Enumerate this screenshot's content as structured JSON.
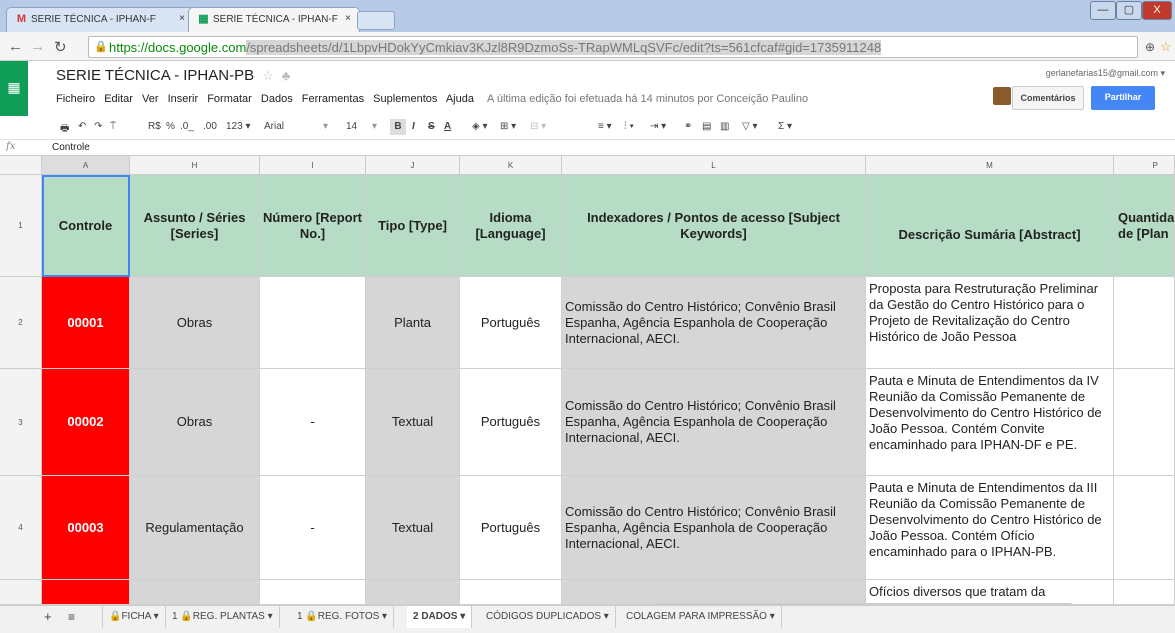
{
  "browser": {
    "tabs": [
      {
        "icon": "M",
        "label": "SERIE TÉCNICA - IPHAN-F",
        "close": "×"
      },
      {
        "icon": "▦",
        "label": "SERIE TÉCNICA - IPHAN-F",
        "close": "×"
      }
    ],
    "url_host": "https://docs.google.com",
    "url_path": "/spreadsheets/d/1LbpvHDokYyCmkiav3KJzl8R9DzmoSs-TRapWMLqSVFc/edit?ts=561cfcaf#gid=1735911248",
    "window_controls": [
      "—",
      "▢",
      "X"
    ]
  },
  "app": {
    "title": "SERIE TÉCNICA - IPHAN-PB",
    "menus": [
      "Ficheiro",
      "Editar",
      "Ver",
      "Inserir",
      "Formatar",
      "Dados",
      "Ferramentas",
      "Suplementos",
      "Ajuda"
    ],
    "last_edit": "A última edição foi efetuada há 14 minutos por Conceição Paulino",
    "email": "gerlanefarias15@gmail.com ▾",
    "comments_label": "Comentários",
    "share_label": "Partilhar"
  },
  "toolbar": {
    "currency": "R$",
    "percent": "%",
    "dec_less": ".0_",
    "dec_more": ".00",
    "format": "123 ▾",
    "font": "Arial",
    "font_size": "14",
    "bold": "B",
    "italic": "I",
    "strike": "S",
    "color": "A"
  },
  "formula_bar": {
    "fx": "fx",
    "value": "Controle"
  },
  "columns": [
    "A",
    "H",
    "I",
    "J",
    "K",
    "L",
    "M",
    "P"
  ],
  "headers": [
    "Controle",
    "Assunto / Séries [Series]",
    "Número [Report No.]",
    "Tipo [Type]",
    "Idioma [Language]",
    "Indexadores / Pontos de acesso [Subject Keywords]",
    "Descrição Sumária [Abstract]",
    "Quantida de [Plan"
  ],
  "row_numbers": [
    "1",
    "2",
    "3",
    "4"
  ],
  "rows": [
    {
      "controle": "00001",
      "assunto": "Obras",
      "numero": "",
      "tipo": "Planta",
      "idioma": "Português",
      "indexadores": "Comissão do Centro Histórico; Convênio Brasil Espanha, Agência Espanhola de Cooperação Internacional, AECI.",
      "descricao": "Proposta para Restruturação Preliminar da Gestão do Centro Histórico para o Projeto de Revitalização do Centro Histórico de João Pessoa"
    },
    {
      "controle": "00002",
      "assunto": "Obras",
      "numero": "-",
      "tipo": "Textual",
      "idioma": "Português",
      "indexadores": "Comissão do Centro Histórico; Convênio Brasil Espanha, Agência Espanhola de Cooperação Internacional, AECI.",
      "descricao": "Pauta e Minuta de Entendimentos da IV Reunião da Comissão Pemanente de Desenvolvimento do Centro Histórico de João Pessoa. Contém Convite encaminhado para IPHAN-DF e PE."
    },
    {
      "controle": "00003",
      "assunto": "Regulamentação",
      "numero": "-",
      "tipo": "Textual",
      "idioma": "Português",
      "indexadores": "Comissão do Centro Histórico; Convênio Brasil Espanha, Agência Espanhola de Cooperação Internacional, AECI.",
      "descricao": "Pauta e Minuta de Entendimentos da III Reunião da Comissão Pemanente de Desenvolvimento do Centro Histórico de João Pessoa. Contém Ofício encaminhado para o IPHAN-PB."
    }
  ],
  "partial_row_text": "Ofícios diversos que tratam da",
  "sheets": [
    {
      "label": "🔒FICHA ▾"
    },
    {
      "label": "1 🔒REG. PLANTAS ▾"
    },
    {
      "label": "1 🔒REG. FOTOS ▾"
    },
    {
      "label": "2 DADOS ▾"
    },
    {
      "label": "CÓDIGOS DUPLICADOS ▾"
    },
    {
      "label": "COLAGEM PARA IMPRESSÃO ▾"
    }
  ],
  "colors": {
    "header_green": "#b6dcc5",
    "control_red": "#ff0000",
    "share_blue": "#4486f6"
  }
}
